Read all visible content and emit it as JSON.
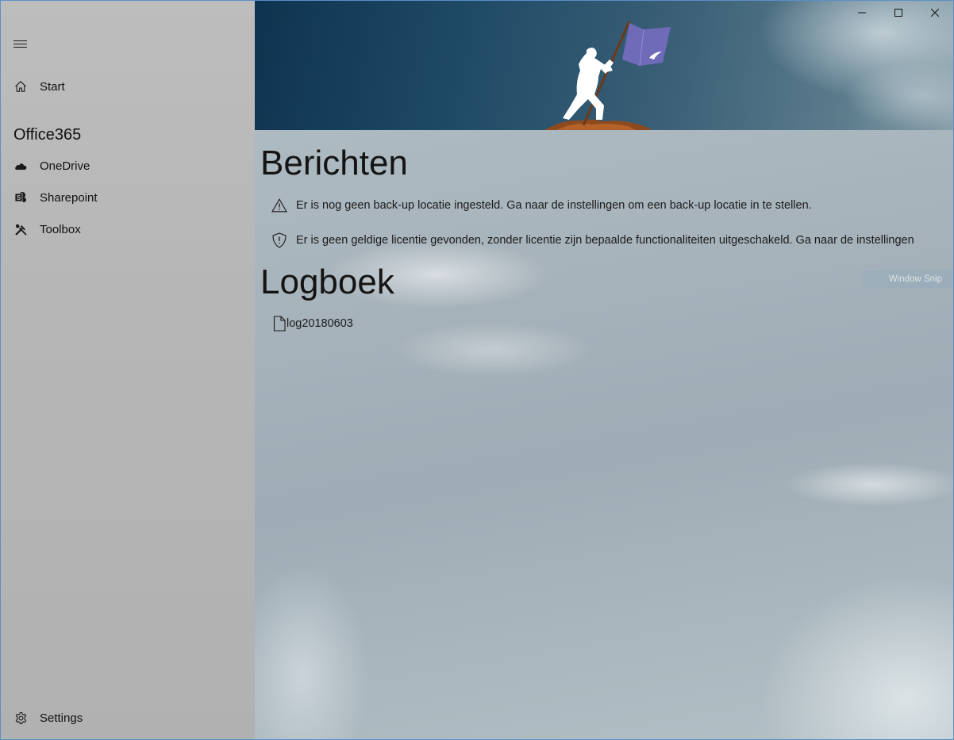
{
  "sidebar": {
    "menu_icon": "hamburger-icon",
    "items": [
      {
        "label": "Start",
        "icon": "home-icon"
      }
    ],
    "section_header": "Office365",
    "section_items": [
      {
        "label": "OneDrive",
        "icon": "cloud-icon"
      },
      {
        "label": "Sharepoint",
        "icon": "sharepoint-icon"
      },
      {
        "label": "Toolbox",
        "icon": "tools-icon"
      }
    ],
    "settings": {
      "label": "Settings",
      "icon": "gear-icon"
    }
  },
  "window_controls": {
    "minimize": "minimize-icon",
    "maximize": "maximize-icon",
    "close": "close-icon"
  },
  "main": {
    "messages_heading": "Berichten",
    "messages": [
      {
        "icon": "warning-icon",
        "text": "Er is nog geen back-up locatie ingesteld. Ga naar de instellingen om een back-up locatie in te stellen."
      },
      {
        "icon": "shield-icon",
        "text": "Er is geen geldige licentie gevonden, zonder licentie zijn bepaalde functionaliteiten uitgeschakeld. Ga naar de instellingen"
      }
    ],
    "log_heading": "Logboek",
    "log_files": [
      {
        "icon": "document-icon",
        "name": "log20180603"
      }
    ],
    "overlay_badge": "Window Snip"
  },
  "colors": {
    "banner_dark": "#0e3350",
    "flag": "#6f6bb8",
    "sidebar_bg": "#b8b8b8"
  }
}
